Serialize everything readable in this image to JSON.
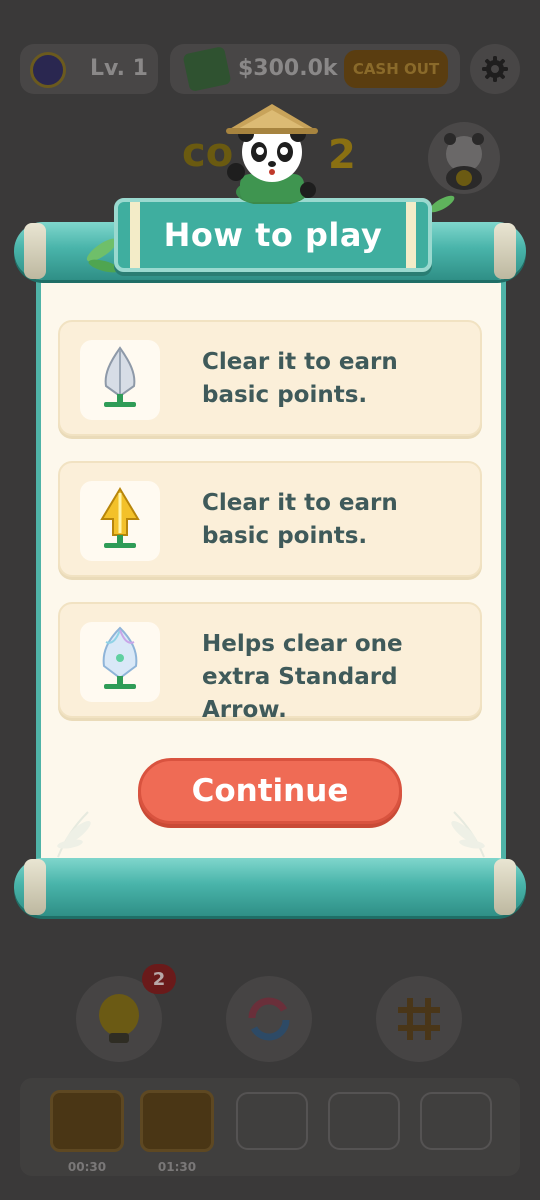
{
  "topbar": {
    "level_label": "Lv. 1",
    "cash_value": "$300.0k",
    "cashout_label": "CASH OUT"
  },
  "stage": {
    "label_partial": "co",
    "number": "2"
  },
  "modal": {
    "title": "How to play",
    "items": [
      {
        "icon": "silver-arrow-icon",
        "text": "Clear it to earn basic points."
      },
      {
        "icon": "gold-arrow-icon",
        "text": "Clear it to earn basic points."
      },
      {
        "icon": "crystal-arrow-icon",
        "text": "Helps clear one extra Standard Arrow."
      }
    ],
    "continue_label": "Continue"
  },
  "tools": {
    "hint_badge_count": "2"
  },
  "tray": {
    "chest_timers": [
      "00:30",
      "01:30"
    ]
  },
  "colors": {
    "accent_teal": "#3fae9f",
    "continue_button": "#ef6b55",
    "card_bg": "#fbefd9",
    "text_dark": "#3f5a5a"
  }
}
